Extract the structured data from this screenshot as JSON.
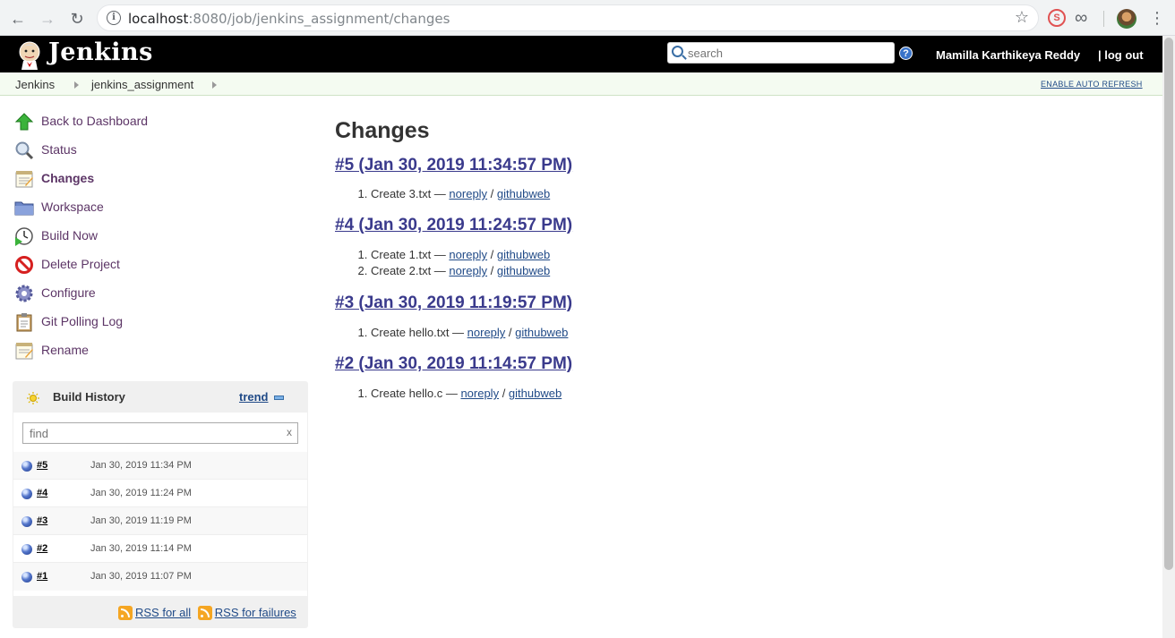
{
  "browser": {
    "url_host": "localhost",
    "url_rest": ":8080/job/jenkins_assignment/changes"
  },
  "header": {
    "brand": "Jenkins",
    "search_placeholder": "search",
    "user": "Mamilla Karthikeya Reddy",
    "logout": "log out"
  },
  "breadcrumb": {
    "items": [
      "Jenkins",
      "jenkins_assignment"
    ],
    "auto_refresh": "ENABLE AUTO REFRESH"
  },
  "tasks": [
    {
      "label": "Back to Dashboard",
      "icon": "up-arrow-icon"
    },
    {
      "label": "Status",
      "icon": "magnifier-icon"
    },
    {
      "label": "Changes",
      "icon": "notepad-icon"
    },
    {
      "label": "Workspace",
      "icon": "folder-icon"
    },
    {
      "label": "Build Now",
      "icon": "clock-play-icon"
    },
    {
      "label": "Delete Project",
      "icon": "no-entry-icon"
    },
    {
      "label": "Configure",
      "icon": "gear-icon"
    },
    {
      "label": "Git Polling Log",
      "icon": "clipboard-icon"
    },
    {
      "label": "Rename",
      "icon": "notepad-icon"
    }
  ],
  "build_history": {
    "title": "Build History",
    "trend": "trend",
    "find_placeholder": "find",
    "clear": "x",
    "builds": [
      {
        "num": "#5",
        "date": "Jan 30, 2019 11:34 PM"
      },
      {
        "num": "#4",
        "date": "Jan 30, 2019 11:24 PM"
      },
      {
        "num": "#3",
        "date": "Jan 30, 2019 11:19 PM"
      },
      {
        "num": "#2",
        "date": "Jan 30, 2019 11:14 PM"
      },
      {
        "num": "#1",
        "date": "Jan 30, 2019 11:07 PM"
      }
    ],
    "rss_all": "RSS for all",
    "rss_failures": "RSS for failures"
  },
  "main": {
    "title": "Changes",
    "builds": [
      {
        "heading": "#5 (Jan 30, 2019 11:34:57 PM)",
        "changes": [
          {
            "msg": "Create 3.txt — ",
            "author": "noreply",
            "sep": " / ",
            "link": "githubweb"
          }
        ]
      },
      {
        "heading": "#4 (Jan 30, 2019 11:24:57 PM)",
        "changes": [
          {
            "msg": "Create 1.txt — ",
            "author": "noreply",
            "sep": " / ",
            "link": "githubweb"
          },
          {
            "msg": "Create 2.txt — ",
            "author": "noreply",
            "sep": " / ",
            "link": "githubweb"
          }
        ]
      },
      {
        "heading": "#3 (Jan 30, 2019 11:19:57 PM)",
        "changes": [
          {
            "msg": "Create hello.txt — ",
            "author": "noreply",
            "sep": " / ",
            "link": "githubweb"
          }
        ]
      },
      {
        "heading": "#2 (Jan 30, 2019 11:14:57 PM)",
        "changes": [
          {
            "msg": "Create hello.c — ",
            "author": "noreply",
            "sep": " / ",
            "link": "githubweb"
          }
        ]
      }
    ]
  }
}
